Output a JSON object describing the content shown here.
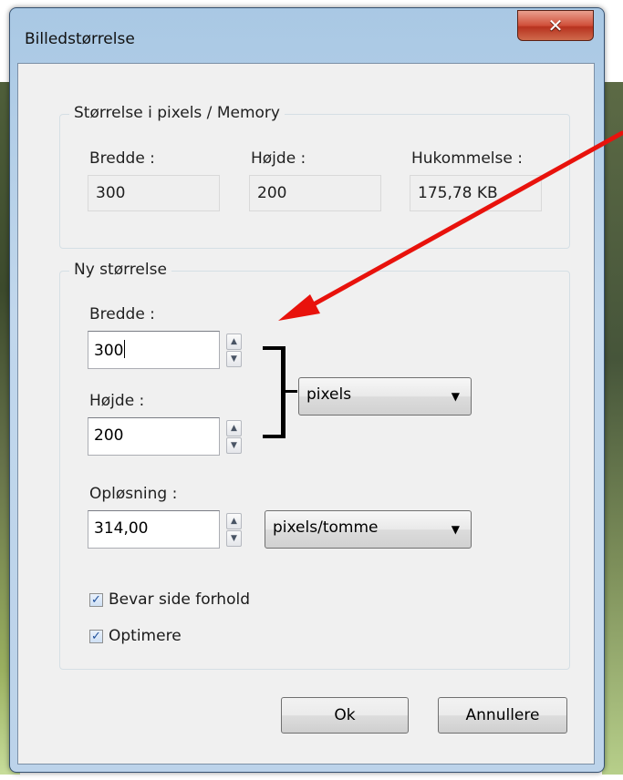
{
  "dialog": {
    "title": "Billedstørrelse",
    "close_symbol": "✕"
  },
  "current_size": {
    "legend": "Størrelse i pixels / Memory",
    "width_label": "Bredde :",
    "width_value": "300",
    "height_label": "Højde :",
    "height_value": "200",
    "memory_label": "Hukommelse :",
    "memory_value": "175,78 KB"
  },
  "new_size": {
    "legend": "Ny størrelse",
    "width_label": "Bredde :",
    "width_value": "300",
    "height_label": "Højde :",
    "height_value": "200",
    "unit_selected": "pixels",
    "resolution_label": "Opløsning :",
    "resolution_value": "314,00",
    "resolution_unit_selected": "pixels/tomme"
  },
  "options": {
    "keep_aspect_label": "Bevar side forhold",
    "keep_aspect_checked": true,
    "optimize_label": "Optimere",
    "optimize_checked": true
  },
  "buttons": {
    "ok_label": "Ok",
    "cancel_label": "Annullere"
  },
  "colors": {
    "annotation_arrow": "#e8120c",
    "title_bar": "#b7d0ea",
    "close_button": "#c9462f"
  },
  "icons": {
    "spin_up": "▲",
    "spin_down": "▼",
    "dropdown_arrow": "▼",
    "checkmark": "✓"
  }
}
